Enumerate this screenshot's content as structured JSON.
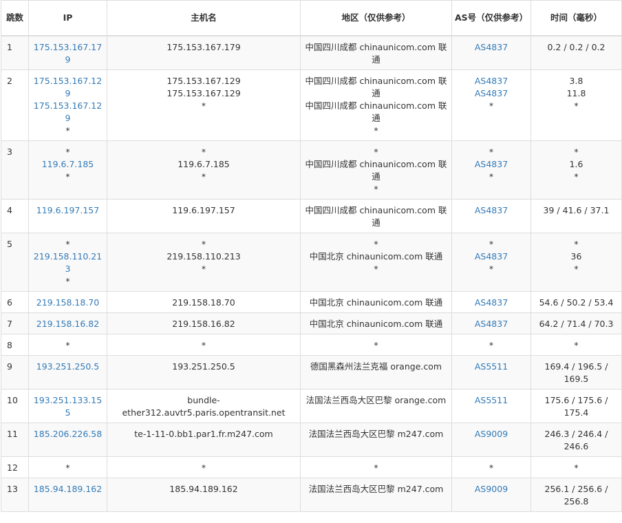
{
  "headers": {
    "hop": "跳数",
    "ip": "IP",
    "host": "主机名",
    "geo": "地区（仅供参考）",
    "as": "AS号（仅供参考）",
    "time": "时间（毫秒）"
  },
  "rows": [
    {
      "hop": "1",
      "ip": [
        "175.153.167.179"
      ],
      "host": [
        "175.153.167.179"
      ],
      "geo": [
        "中国四川成都 chinaunicom.com 联通"
      ],
      "as": [
        "AS4837"
      ],
      "time": [
        "0.2 / 0.2 / 0.2"
      ]
    },
    {
      "hop": "2",
      "ip": [
        "175.153.167.129",
        "175.153.167.129",
        "*"
      ],
      "host": [
        "175.153.167.129",
        "175.153.167.129",
        "*"
      ],
      "geo": [
        "中国四川成都 chinaunicom.com 联通",
        "中国四川成都 chinaunicom.com 联通",
        "*"
      ],
      "as": [
        "AS4837",
        "AS4837",
        "*"
      ],
      "time": [
        "3.8",
        "11.8",
        "*"
      ]
    },
    {
      "hop": "3",
      "ip": [
        "*",
        "119.6.7.185",
        "*"
      ],
      "host": [
        "*",
        "119.6.7.185",
        "*"
      ],
      "geo": [
        "*",
        "中国四川成都 chinaunicom.com 联通",
        "*"
      ],
      "as": [
        "*",
        "AS4837",
        "*"
      ],
      "time": [
        "*",
        "1.6",
        "*"
      ]
    },
    {
      "hop": "4",
      "ip": [
        "119.6.197.157"
      ],
      "host": [
        "119.6.197.157"
      ],
      "geo": [
        "中国四川成都 chinaunicom.com 联通"
      ],
      "as": [
        "AS4837"
      ],
      "time": [
        "39 / 41.6 / 37.1"
      ]
    },
    {
      "hop": "5",
      "ip": [
        "*",
        "219.158.110.213",
        "*"
      ],
      "host": [
        "*",
        "219.158.110.213",
        "*"
      ],
      "geo": [
        "*",
        "中国北京 chinaunicom.com 联通",
        "*"
      ],
      "as": [
        "*",
        "AS4837",
        "*"
      ],
      "time": [
        "*",
        "36",
        "*"
      ]
    },
    {
      "hop": "6",
      "ip": [
        "219.158.18.70"
      ],
      "host": [
        "219.158.18.70"
      ],
      "geo": [
        "中国北京 chinaunicom.com 联通"
      ],
      "as": [
        "AS4837"
      ],
      "time": [
        "54.6 / 50.2 / 53.4"
      ]
    },
    {
      "hop": "7",
      "ip": [
        "219.158.16.82"
      ],
      "host": [
        "219.158.16.82"
      ],
      "geo": [
        "中国北京 chinaunicom.com 联通"
      ],
      "as": [
        "AS4837"
      ],
      "time": [
        "64.2 / 71.4 / 70.3"
      ]
    },
    {
      "hop": "8",
      "ip": [
        "*"
      ],
      "host": [
        "*"
      ],
      "geo": [
        "*"
      ],
      "as": [
        "*"
      ],
      "time": [
        "*"
      ]
    },
    {
      "hop": "9",
      "ip": [
        "193.251.250.5"
      ],
      "host": [
        "193.251.250.5"
      ],
      "geo": [
        "德国黑森州法兰克福 orange.com"
      ],
      "as": [
        "AS5511"
      ],
      "time": [
        "169.4 / 196.5 / 169.5"
      ]
    },
    {
      "hop": "10",
      "ip": [
        "193.251.133.155"
      ],
      "host": [
        "bundle-ether312.auvtr5.paris.opentransit.net"
      ],
      "geo": [
        "法国法兰西岛大区巴黎 orange.com"
      ],
      "as": [
        "AS5511"
      ],
      "time": [
        "175.6 / 175.6 / 175.4"
      ]
    },
    {
      "hop": "11",
      "ip": [
        "185.206.226.58"
      ],
      "host": [
        "te-1-11-0.bb1.par1.fr.m247.com"
      ],
      "geo": [
        "法国法兰西岛大区巴黎 m247.com"
      ],
      "as": [
        "AS9009"
      ],
      "time": [
        "246.3 / 246.4 / 246.6"
      ]
    },
    {
      "hop": "12",
      "ip": [
        "*"
      ],
      "host": [
        "*"
      ],
      "geo": [
        "*"
      ],
      "as": [
        "*"
      ],
      "time": [
        "*"
      ]
    },
    {
      "hop": "13",
      "ip": [
        "185.94.189.162"
      ],
      "host": [
        "185.94.189.162"
      ],
      "geo": [
        "法国法兰西岛大区巴黎 m247.com"
      ],
      "as": [
        "AS9009"
      ],
      "time": [
        "256.1 / 256.6 / 256.8"
      ]
    }
  ],
  "colors": {
    "link": "#337ab7",
    "text": "#333333",
    "border": "#dddddd",
    "stripe": "#f9f9f9"
  }
}
